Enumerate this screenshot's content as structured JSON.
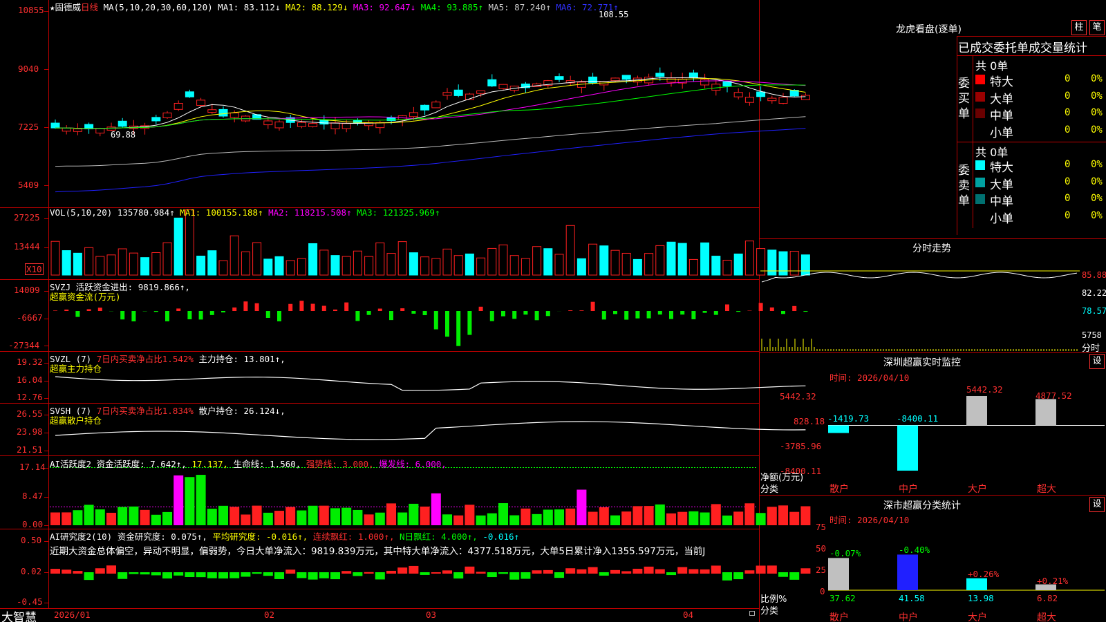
{
  "main_chart": {
    "star": "★",
    "stock_name": "固德威",
    "period": "日线",
    "ma_params": "MA(5,10,20,30,60,120)",
    "ma1": "MA1: 83.112↓",
    "ma2": "MA2: 88.129↓",
    "ma3": "MA3: 92.647↓",
    "ma4": "MA4: 93.885↑",
    "ma5": "MA5: 87.240↑",
    "ma6": "MA6: 72.771↑",
    "y_labels": [
      "10855",
      "9040",
      "7225",
      "5409"
    ],
    "high_mark": "108.55",
    "low_mark": "69.88"
  },
  "vol_panel": {
    "title": "VOL(5,10,20)",
    "value": "135780.984↑",
    "ma1": "MA1: 100155.188↑",
    "ma2": "MA2: 118215.508↑",
    "ma3": "MA3: 121325.969↑",
    "y_labels": [
      "27225",
      "13444"
    ],
    "unit": "X10"
  },
  "svzj_panel": {
    "title": "SVZJ",
    "label": "活跃资金进出: 9819.866↑,",
    "sub": "超赢资金流(万元)",
    "y_labels": [
      "14009",
      "-6667",
      "-27344"
    ]
  },
  "svzl_panel": {
    "title": "SVZL (7)",
    "ratio": "7日内买卖净占比1.542%",
    "hold": "主力持仓: 13.801↑,",
    "sub": "超赢主力持仓",
    "y_labels": [
      "19.32",
      "16.04",
      "12.76"
    ]
  },
  "svsh_panel": {
    "title": "SVSH (7)",
    "ratio": "7日内买卖净占比1.834%",
    "hold": "散户持仓: 26.124↓,",
    "sub": "超赢散户持仓",
    "y_labels": [
      "26.55",
      "23.98",
      "21.51"
    ]
  },
  "ai_active": {
    "title": "AI活跃度2",
    "label1": "资金活跃度: 7.642↑,",
    "label2": "17.137,",
    "label3": "生命线: 1.560,",
    "label4": "强势线: 3.000,",
    "label5": "爆发线: 6.000,",
    "y_labels": [
      "17.14",
      "8.47",
      "0.00"
    ]
  },
  "ai_research": {
    "title": "AI研究度2(10)",
    "label1": "资金研究度: 0.075↑,",
    "label2": "平均研究度: -0.016↑,",
    "label3": "连续飘红: 1.000↑,",
    "label4": "N日飘红: 4.000↑,",
    "label5": "-0.016↑",
    "summary": "近期大资金总体偏空，异动不明显，偏弱势，今日大单净流入：9819.839万元，其中特大单净流入：4377.518万元，大单5日累计净入1355.597万元，当前J",
    "y_labels": [
      "0.50",
      "0.02",
      "-0.45"
    ]
  },
  "x_axis": {
    "logo": "大智慧",
    "labels": [
      "2026/01",
      "02",
      "03",
      "04"
    ]
  },
  "right_panel": {
    "title": "龙虎看盘(逐单)",
    "tab1": "柱",
    "tab2": "笔",
    "header": "已成交委托单成交量统计",
    "buy_label": "委买单",
    "sell_label": "委卖单",
    "buy_total": "共 0单",
    "sell_total": "共 0单",
    "buy_rows": [
      {
        "name": "特大",
        "count": "0",
        "pct": "0%",
        "color": "#ff0000"
      },
      {
        "name": "大单",
        "count": "0",
        "pct": "0%",
        "color": "#9a0000"
      },
      {
        "name": "中单",
        "count": "0",
        "pct": "0%",
        "color": "#6a0000"
      },
      {
        "name": "小单",
        "count": "0",
        "pct": "0%",
        "color": "#000000"
      }
    ],
    "sell_rows": [
      {
        "name": "特大",
        "count": "0",
        "pct": "0%",
        "color": "#00ffff"
      },
      {
        "name": "大单",
        "count": "0",
        "pct": "0%",
        "color": "#00a0a0"
      },
      {
        "name": "中单",
        "count": "0",
        "pct": "0%",
        "color": "#007070"
      },
      {
        "name": "小单",
        "count": "0",
        "pct": "0%",
        "color": "#000000"
      }
    ],
    "intraday": {
      "title": "分时走势",
      "labels": [
        "85.88",
        "82.22",
        "78.57",
        "5758"
      ],
      "unit": "分时"
    },
    "monitor": {
      "title": "深圳超赢实时监控",
      "setting": "设",
      "time": "时间: 2026/04/10",
      "y_labels": [
        "5442.32",
        "828.18",
        "-3785.96",
        "-8400.11"
      ],
      "axis_title": "净额(万元)",
      "category_title": "分类",
      "categories": [
        "散户",
        "中户",
        "大户",
        "超大"
      ],
      "value_labels": [
        "-1419.73",
        "-8400.11",
        "5442.32",
        "4877.52"
      ]
    },
    "stats": {
      "title": "深市超赢分类统计",
      "setting": "设",
      "time": "时间: 2026/04/10",
      "y_labels": [
        "75",
        "50",
        "25",
        "0"
      ],
      "axis_title": "比例%",
      "category_title": "分类",
      "categories": [
        "散户",
        "中户",
        "大户",
        "超大"
      ],
      "change_labels": [
        "-0.07%",
        "-0.40%",
        "+0.26%",
        "+0.21%"
      ],
      "values_text": [
        "37.62",
        "41.58",
        "13.98",
        "6.82"
      ]
    }
  },
  "chart_data": [
    {
      "type": "bar",
      "title": "深圳超赢实时监控",
      "ylabel": "净额(万元)",
      "categories": [
        "散户",
        "中户",
        "大户",
        "超大"
      ],
      "values": [
        -1419.73,
        -8400.11,
        5442.32,
        4877.52
      ],
      "ylim": [
        -8400.11,
        5442.32
      ]
    },
    {
      "type": "bar",
      "title": "深市超赢分类统计",
      "ylabel": "比例%",
      "categories": [
        "散户",
        "中户",
        "大户",
        "超大"
      ],
      "values": [
        37.62,
        41.58,
        13.98,
        6.82
      ],
      "ylim": [
        0,
        75
      ]
    }
  ]
}
